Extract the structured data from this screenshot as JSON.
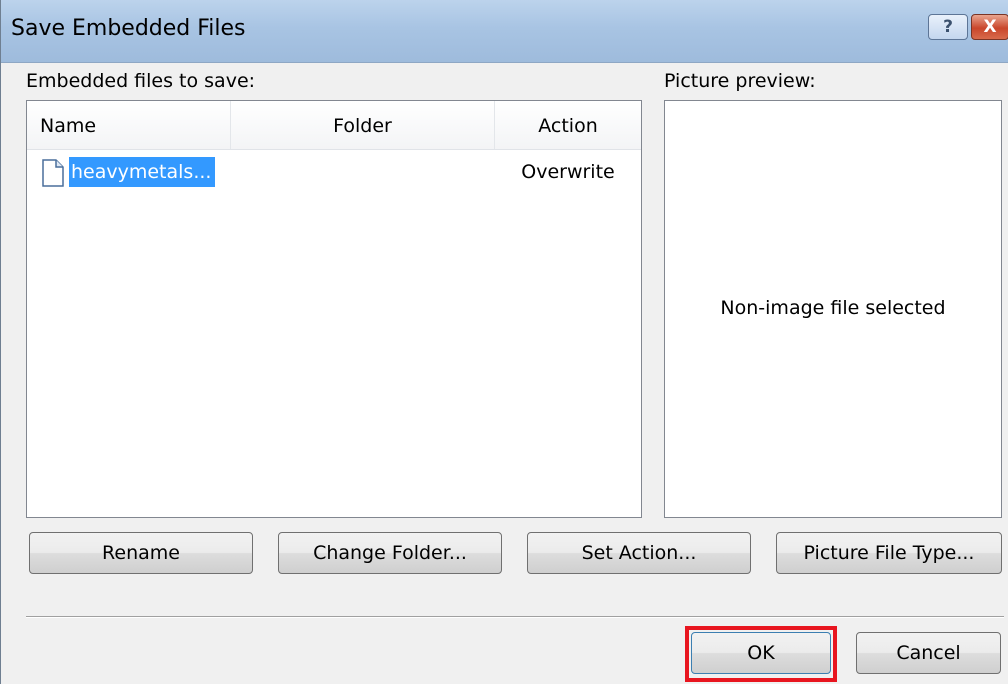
{
  "window": {
    "title": "Save Embedded Files",
    "help_glyph": "?",
    "close_glyph": "X"
  },
  "embedded_list": {
    "label": "Embedded files to save:",
    "columns": [
      "Name",
      "Folder",
      "Action"
    ],
    "rows": [
      {
        "name": "heavymetals...",
        "folder": "",
        "action": "Overwrite",
        "icon": "file-icon",
        "selected": true
      }
    ]
  },
  "preview": {
    "label": "Picture preview:",
    "message": "Non-image file selected"
  },
  "buttons": {
    "rename": "Rename",
    "change_folder": "Change Folder...",
    "set_action": "Set Action...",
    "picture_file_type": "Picture File Type...",
    "ok": "OK",
    "cancel": "Cancel"
  },
  "colors": {
    "selection": "#3399ff",
    "ok_highlight": "#e8151f"
  }
}
